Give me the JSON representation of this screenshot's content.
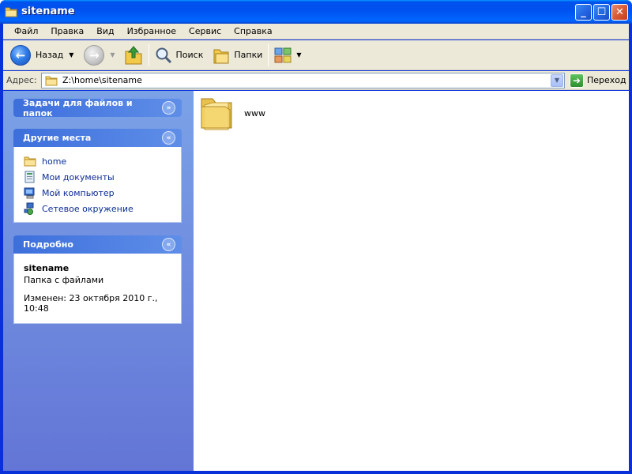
{
  "window": {
    "title": "sitename"
  },
  "menu": [
    {
      "label": "Файл"
    },
    {
      "label": "Правка"
    },
    {
      "label": "Вид"
    },
    {
      "label": "Избранное"
    },
    {
      "label": "Сервис"
    },
    {
      "label": "Справка"
    }
  ],
  "toolbar": {
    "back_label": "Назад",
    "search_label": "Поиск",
    "folders_label": "Папки"
  },
  "address": {
    "label": "Адрес:",
    "path": "Z:\\home\\sitename",
    "go_label": "Переход"
  },
  "tasks_panel": {
    "title": "Задачи для файлов и папок"
  },
  "places_panel": {
    "title": "Другие места",
    "items": [
      {
        "label": "home",
        "icon": "folder-icon"
      },
      {
        "label": "Мои документы",
        "icon": "my-documents-icon"
      },
      {
        "label": "Мой компьютер",
        "icon": "my-computer-icon"
      },
      {
        "label": "Сетевое окружение",
        "icon": "network-icon"
      }
    ]
  },
  "details_panel": {
    "title": "Подробно",
    "name": "sitename",
    "type": "Папка с файлами",
    "modified": "Изменен: 23 октября 2010 г., 10:48"
  },
  "files": [
    {
      "name": "www",
      "icon": "folder-icon"
    }
  ],
  "colors": {
    "titlebar": "#0053ee",
    "chrome": "#ece9d8",
    "sidebar": "#7ba2e7",
    "link": "#0c2d95"
  }
}
